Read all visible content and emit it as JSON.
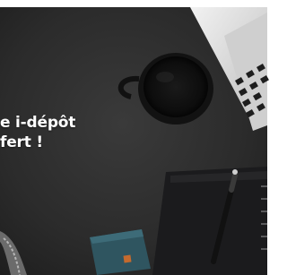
{
  "banner": {
    "headline_line1": "e i-dépôt",
    "headline_line2": "fert !"
  },
  "colors": {
    "desk": "#2b2b2b",
    "page_background": "#ffffff",
    "text": "#ffffff"
  }
}
